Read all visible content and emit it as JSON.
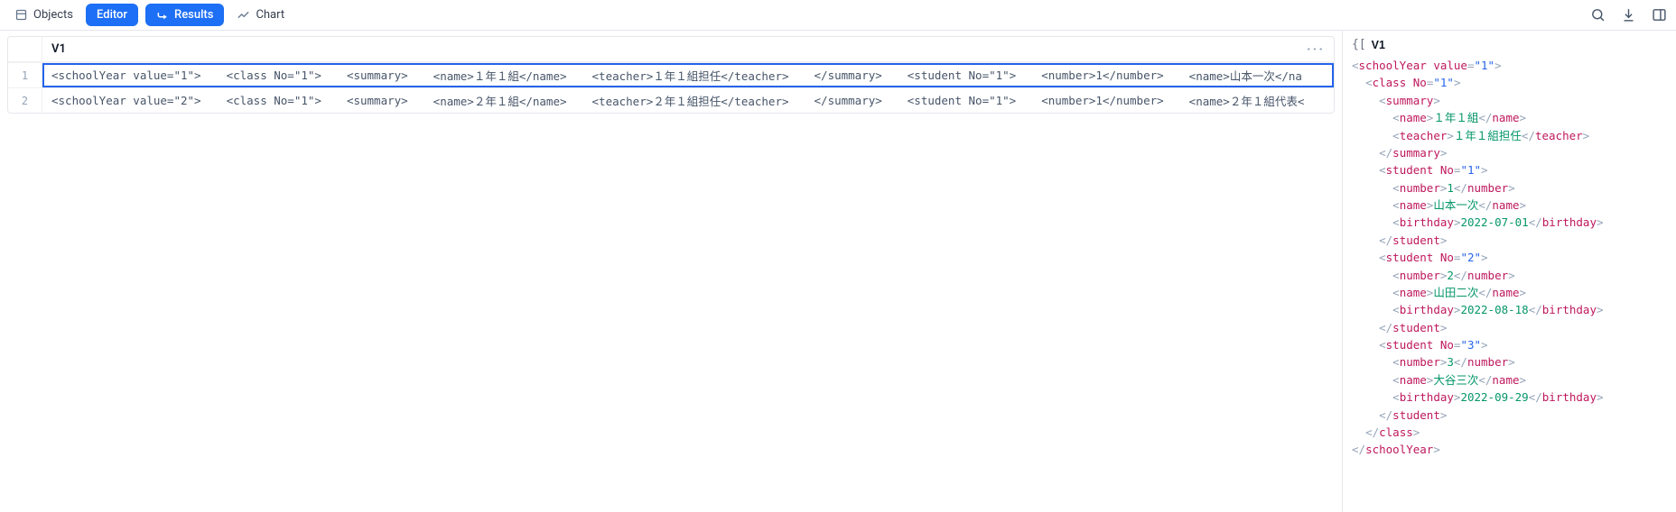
{
  "toolbar": {
    "objects_label": "Objects",
    "editor_label": "Editor",
    "results_label": "Results",
    "chart_label": "Chart"
  },
  "grid": {
    "column_header": "V1",
    "rows": [
      {
        "num": "1",
        "fragments": [
          "<schoolYear value=\"1\">",
          "<class No=\"1\">",
          "<summary>",
          "<name>１年１組</name>",
          "<teacher>１年１組担任</teacher>",
          "</summary>",
          "<student No=\"1\">",
          "<number>1</number>",
          "<name>山本一次</na"
        ]
      },
      {
        "num": "2",
        "fragments": [
          "<schoolYear value=\"2\">",
          "<class No=\"1\">",
          "<summary>",
          "<name>２年１組</name>",
          "<teacher>２年１組担任</teacher>",
          "</summary>",
          "<student No=\"1\">",
          "<number>1</number>",
          "<name>２年１組代表<"
        ]
      }
    ]
  },
  "detail": {
    "column_header": "V1",
    "xml": [
      {
        "indent": 0,
        "type": "open",
        "tag": "schoolYear",
        "attr": "value",
        "val": "\"1\""
      },
      {
        "indent": 1,
        "type": "open",
        "tag": "class",
        "attr": "No",
        "val": "\"1\""
      },
      {
        "indent": 2,
        "type": "open",
        "tag": "summary"
      },
      {
        "indent": 3,
        "type": "leaf",
        "tag": "name",
        "text": "１年１組"
      },
      {
        "indent": 3,
        "type": "leaf",
        "tag": "teacher",
        "text": "１年１組担任"
      },
      {
        "indent": 2,
        "type": "close",
        "tag": "summary"
      },
      {
        "indent": 2,
        "type": "open",
        "tag": "student",
        "attr": "No",
        "val": "\"1\""
      },
      {
        "indent": 3,
        "type": "leaf",
        "tag": "number",
        "text": "1"
      },
      {
        "indent": 3,
        "type": "leaf",
        "tag": "name",
        "text": "山本一次"
      },
      {
        "indent": 3,
        "type": "leaf",
        "tag": "birthday",
        "text": "2022-07-01"
      },
      {
        "indent": 2,
        "type": "close",
        "tag": "student"
      },
      {
        "indent": 2,
        "type": "open",
        "tag": "student",
        "attr": "No",
        "val": "\"2\""
      },
      {
        "indent": 3,
        "type": "leaf",
        "tag": "number",
        "text": "2"
      },
      {
        "indent": 3,
        "type": "leaf",
        "tag": "name",
        "text": "山田二次"
      },
      {
        "indent": 3,
        "type": "leaf",
        "tag": "birthday",
        "text": "2022-08-18"
      },
      {
        "indent": 2,
        "type": "close",
        "tag": "student"
      },
      {
        "indent": 2,
        "type": "open",
        "tag": "student",
        "attr": "No",
        "val": "\"3\""
      },
      {
        "indent": 3,
        "type": "leaf",
        "tag": "number",
        "text": "3"
      },
      {
        "indent": 3,
        "type": "leaf",
        "tag": "name",
        "text": "大谷三次"
      },
      {
        "indent": 3,
        "type": "leaf",
        "tag": "birthday",
        "text": "2022-09-29"
      },
      {
        "indent": 2,
        "type": "close",
        "tag": "student"
      },
      {
        "indent": 1,
        "type": "close",
        "tag": "class"
      },
      {
        "indent": 0,
        "type": "close",
        "tag": "schoolYear"
      }
    ]
  }
}
